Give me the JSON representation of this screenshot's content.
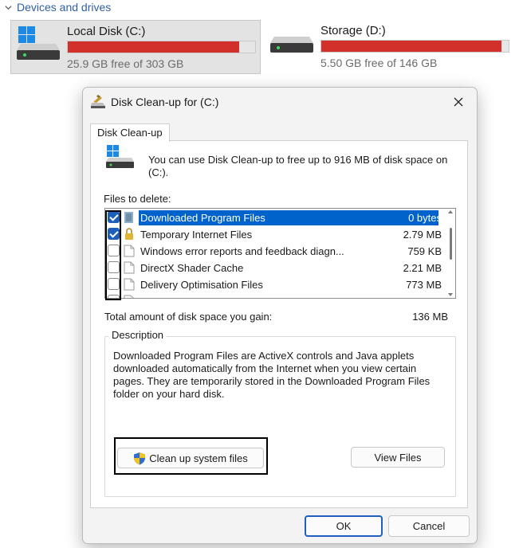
{
  "explorer": {
    "section_title": "Devices and drives",
    "drives": [
      {
        "name": "Local Disk (C:)",
        "free_text": "25.9 GB free of 303 GB",
        "used_fraction": 0.915,
        "selected": true
      },
      {
        "name": "Storage (D:)",
        "free_text": "5.50 GB free of 146 GB",
        "used_fraction": 0.962,
        "selected": false
      }
    ],
    "bar_color": "#d1312a"
  },
  "dialog": {
    "title": "Disk Clean-up for  (C:)",
    "tab_label": "Disk Clean-up",
    "intro_text": "You can use Disk Clean-up to free up to 916 MB of disk space on (C:).",
    "files_label": "Files to delete:",
    "files": [
      {
        "label": "Downloaded Program Files",
        "size": "0 bytes",
        "checked": true,
        "selected": true,
        "icon": "folder-icon"
      },
      {
        "label": "Temporary Internet Files",
        "size": "2.79 MB",
        "checked": true,
        "selected": false,
        "icon": "lock-icon"
      },
      {
        "label": "Windows error reports and feedback diagn...",
        "size": "759 KB",
        "checked": false,
        "selected": false,
        "icon": "file-icon"
      },
      {
        "label": "DirectX Shader Cache",
        "size": "2.21 MB",
        "checked": false,
        "selected": false,
        "icon": "file-icon"
      },
      {
        "label": "Delivery Optimisation Files",
        "size": "773 MB",
        "checked": false,
        "selected": false,
        "icon": "file-icon"
      }
    ],
    "total_label": "Total amount of disk space you gain:",
    "total_value": "136 MB",
    "description_title": "Description",
    "description_text": "Downloaded Program Files are ActiveX controls and Java applets downloaded automatically from the Internet when you view certain pages. They are temporarily stored in the Downloaded Program Files folder on your hard disk.",
    "cleanup_button": "Clean up system files",
    "view_files_button": "View Files",
    "ok_button": "OK",
    "cancel_button": "Cancel"
  },
  "colors": {
    "accent": "#0063cc",
    "ok_border": "#1f5fbf"
  }
}
